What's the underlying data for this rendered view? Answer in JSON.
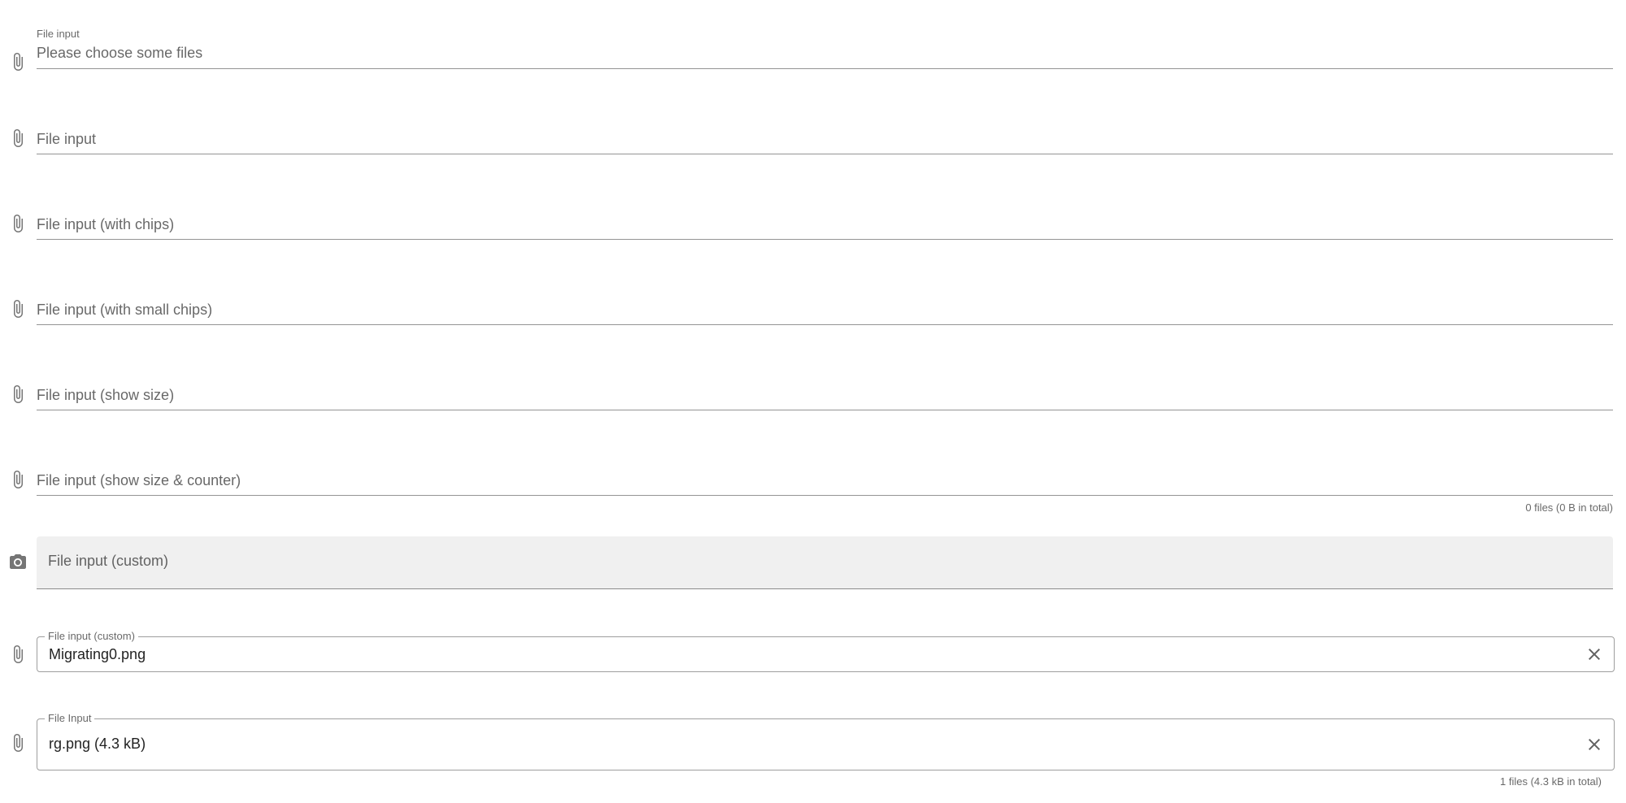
{
  "fields": [
    {
      "icon": "paperclip-icon",
      "label": "File input",
      "placeholder": "Please choose some files"
    },
    {
      "icon": "paperclip-icon",
      "label": "File input"
    },
    {
      "icon": "paperclip-icon",
      "label": "File input (with chips)"
    },
    {
      "icon": "paperclip-icon",
      "label": "File input (with small chips)"
    },
    {
      "icon": "paperclip-icon",
      "label": "File input (show size)"
    },
    {
      "icon": "paperclip-icon",
      "label": "File input (show size & counter)",
      "counter": "0 files (0 B in total)"
    },
    {
      "icon": "camera-icon",
      "label": "File input (custom)"
    },
    {
      "icon": "paperclip-icon",
      "label": "File input (custom)",
      "value": "Migrating0.png",
      "clear_icon": "close-icon"
    },
    {
      "icon": "paperclip-icon",
      "label": "File Input",
      "value": "rg.png (4.3 kB)",
      "counter": "1 files (4.3 kB in total)",
      "clear_icon": "close-icon"
    }
  ],
  "colors": {
    "text_primary": "#000000de",
    "text_secondary": "#00000099",
    "filled_background": "#f0f0f0",
    "icon": "#757575"
  }
}
